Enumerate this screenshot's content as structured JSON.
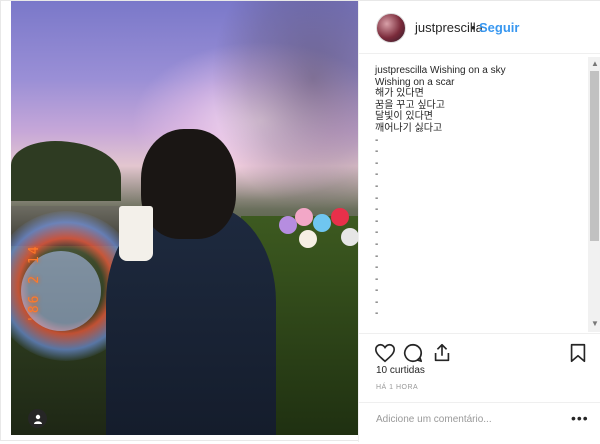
{
  "post": {
    "photo_datestamp": "'86 2 14",
    "photo_alt": "photo"
  },
  "header": {
    "username": "justprescilla",
    "separator": "•",
    "follow_label": "Seguir"
  },
  "caption": {
    "username": "justprescilla",
    "text": "Wishing on a sky\nWishing on a scar\n해가 있다면\n꿈을 꾸고 싶다고\n달빛이 있다면\n깨어나기 싫다고\n-\n-\n-\n-\n-\n-\n-\n-\n-\n-\n-\n-\n-\n-\n-\n-"
  },
  "actions": {
    "like_icon": "heart-icon",
    "comment_icon": "comment-icon",
    "share_icon": "share-icon",
    "save_icon": "bookmark-icon",
    "likes_text": "10 curtidas",
    "time_text": "HÁ 1 HORA"
  },
  "comment": {
    "placeholder": "Adicione um comentário...",
    "more_label": "•••"
  },
  "colors": {
    "accent": "#3897f0",
    "text": "#262626",
    "muted": "#999999",
    "datestamp": "#ff7a2a"
  }
}
